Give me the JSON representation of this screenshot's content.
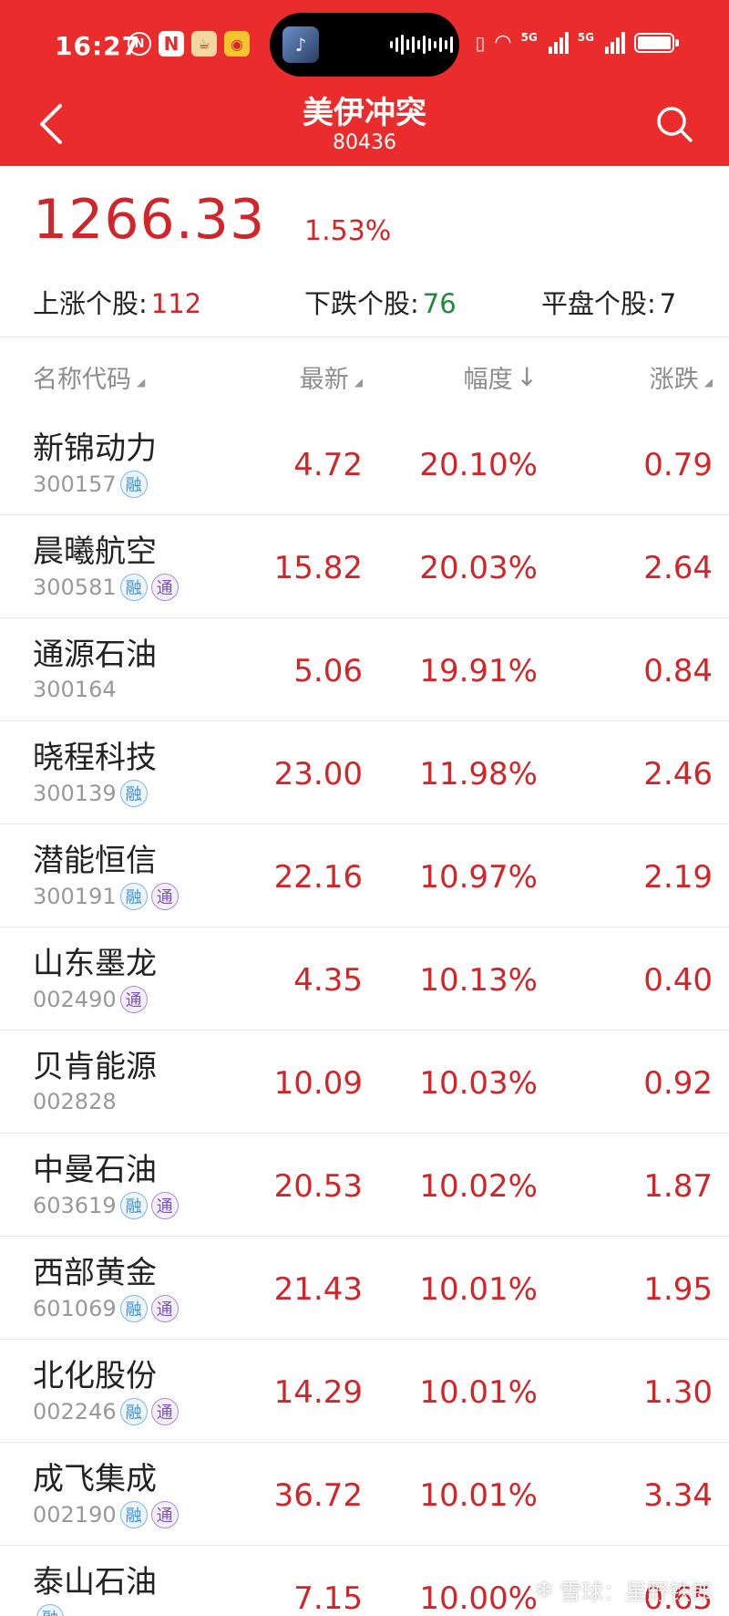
{
  "status_bar": {
    "time": "16:27",
    "net_tag_1": "5G",
    "net_tag_2": "5G",
    "battery_level": 1.0
  },
  "header": {
    "title": "美伊冲突",
    "code": "80436",
    "back_icon": "chevron-left-icon",
    "search_icon": "search-icon",
    "bg_color": "#eb2c2c"
  },
  "summary": {
    "index_value": "1266.33",
    "index_change": "1.53%",
    "up_label": "上涨个股:",
    "up_count": "112",
    "down_label": "下跌个股:",
    "down_count": "76",
    "flat_label": "平盘个股:",
    "flat_count": "7"
  },
  "table": {
    "headers": {
      "name": "名称代码",
      "price": "最新",
      "pct": "幅度",
      "change": "涨跌"
    },
    "rows": [
      {
        "name": "新锦动力",
        "code": "300157",
        "rong": true,
        "tong": false,
        "price": "4.72",
        "pct": "20.10%",
        "change": "0.79"
      },
      {
        "name": "晨曦航空",
        "code": "300581",
        "rong": true,
        "tong": true,
        "price": "15.82",
        "pct": "20.03%",
        "change": "2.64"
      },
      {
        "name": "通源石油",
        "code": "300164",
        "rong": false,
        "tong": false,
        "price": "5.06",
        "pct": "19.91%",
        "change": "0.84"
      },
      {
        "name": "晓程科技",
        "code": "300139",
        "rong": true,
        "tong": false,
        "price": "23.00",
        "pct": "11.98%",
        "change": "2.46"
      },
      {
        "name": "潜能恒信",
        "code": "300191",
        "rong": true,
        "tong": true,
        "price": "22.16",
        "pct": "10.97%",
        "change": "2.19"
      },
      {
        "name": "山东墨龙",
        "code": "002490",
        "rong": false,
        "tong": true,
        "price": "4.35",
        "pct": "10.13%",
        "change": "0.40"
      },
      {
        "name": "贝肯能源",
        "code": "002828",
        "rong": false,
        "tong": false,
        "price": "10.09",
        "pct": "10.03%",
        "change": "0.92"
      },
      {
        "name": "中曼石油",
        "code": "603619",
        "rong": true,
        "tong": true,
        "price": "20.53",
        "pct": "10.02%",
        "change": "1.87"
      },
      {
        "name": "西部黄金",
        "code": "601069",
        "rong": true,
        "tong": true,
        "price": "21.43",
        "pct": "10.01%",
        "change": "1.95"
      },
      {
        "name": "北化股份",
        "code": "002246",
        "rong": true,
        "tong": true,
        "price": "14.29",
        "pct": "10.01%",
        "change": "1.30"
      },
      {
        "name": "成飞集成",
        "code": "002190",
        "rong": true,
        "tong": true,
        "price": "36.72",
        "pct": "10.01%",
        "change": "3.34"
      },
      {
        "name": "泰山石油",
        "code": "",
        "rong": true,
        "tong": false,
        "price": "7.15",
        "pct": "10.00%",
        "change": "0.65"
      }
    ],
    "badge_rong": "融",
    "badge_tong": "通"
  },
  "watermark": {
    "text": "雪球：星野铁郎"
  },
  "colors": {
    "up": "#d0262a",
    "down": "#1f8a3a"
  }
}
